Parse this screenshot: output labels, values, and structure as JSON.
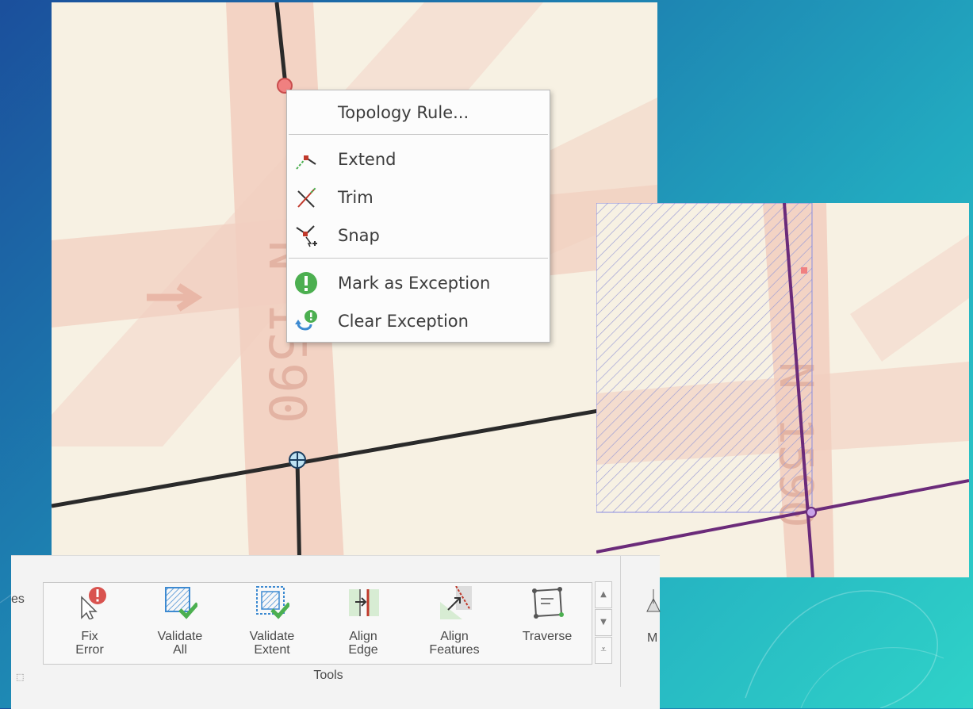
{
  "context_menu": {
    "items": [
      {
        "label": "Topology Rule...",
        "icon": "none"
      },
      {
        "label": "Extend",
        "icon": "extend-icon"
      },
      {
        "label": "Trim",
        "icon": "trim-icon"
      },
      {
        "label": "Snap",
        "icon": "snap-icon"
      },
      {
        "label": "Mark as Exception",
        "icon": "mark-exception-icon"
      },
      {
        "label": "Clear Exception",
        "icon": "clear-exception-icon"
      }
    ]
  },
  "map": {
    "road_label": "N 1590",
    "road_label_2": "N 1590"
  },
  "ribbon": {
    "left_partial": "es",
    "tools": [
      {
        "line1": "Fix",
        "line2": "Error",
        "icon": "fix-error-icon"
      },
      {
        "line1": "Validate",
        "line2": "All",
        "icon": "validate-all-icon"
      },
      {
        "line1": "Validate",
        "line2": "Extent",
        "icon": "validate-extent-icon"
      },
      {
        "line1": "Align",
        "line2": "Edge",
        "icon": "align-edge-icon"
      },
      {
        "line1": "Align",
        "line2": "Features",
        "icon": "align-features-icon"
      },
      {
        "line1": "Traverse",
        "line2": "",
        "icon": "traverse-icon"
      }
    ],
    "group_label": "Tools",
    "right_partial": "M"
  },
  "colors": {
    "map_bg": "#f7f1e3",
    "road": "#f2cfc0",
    "line": "#2a2a2a",
    "purple_line": "#6b2b7a",
    "hatch": "#9a9bd6",
    "error_red": "#d9534f",
    "green": "#4caf50"
  }
}
